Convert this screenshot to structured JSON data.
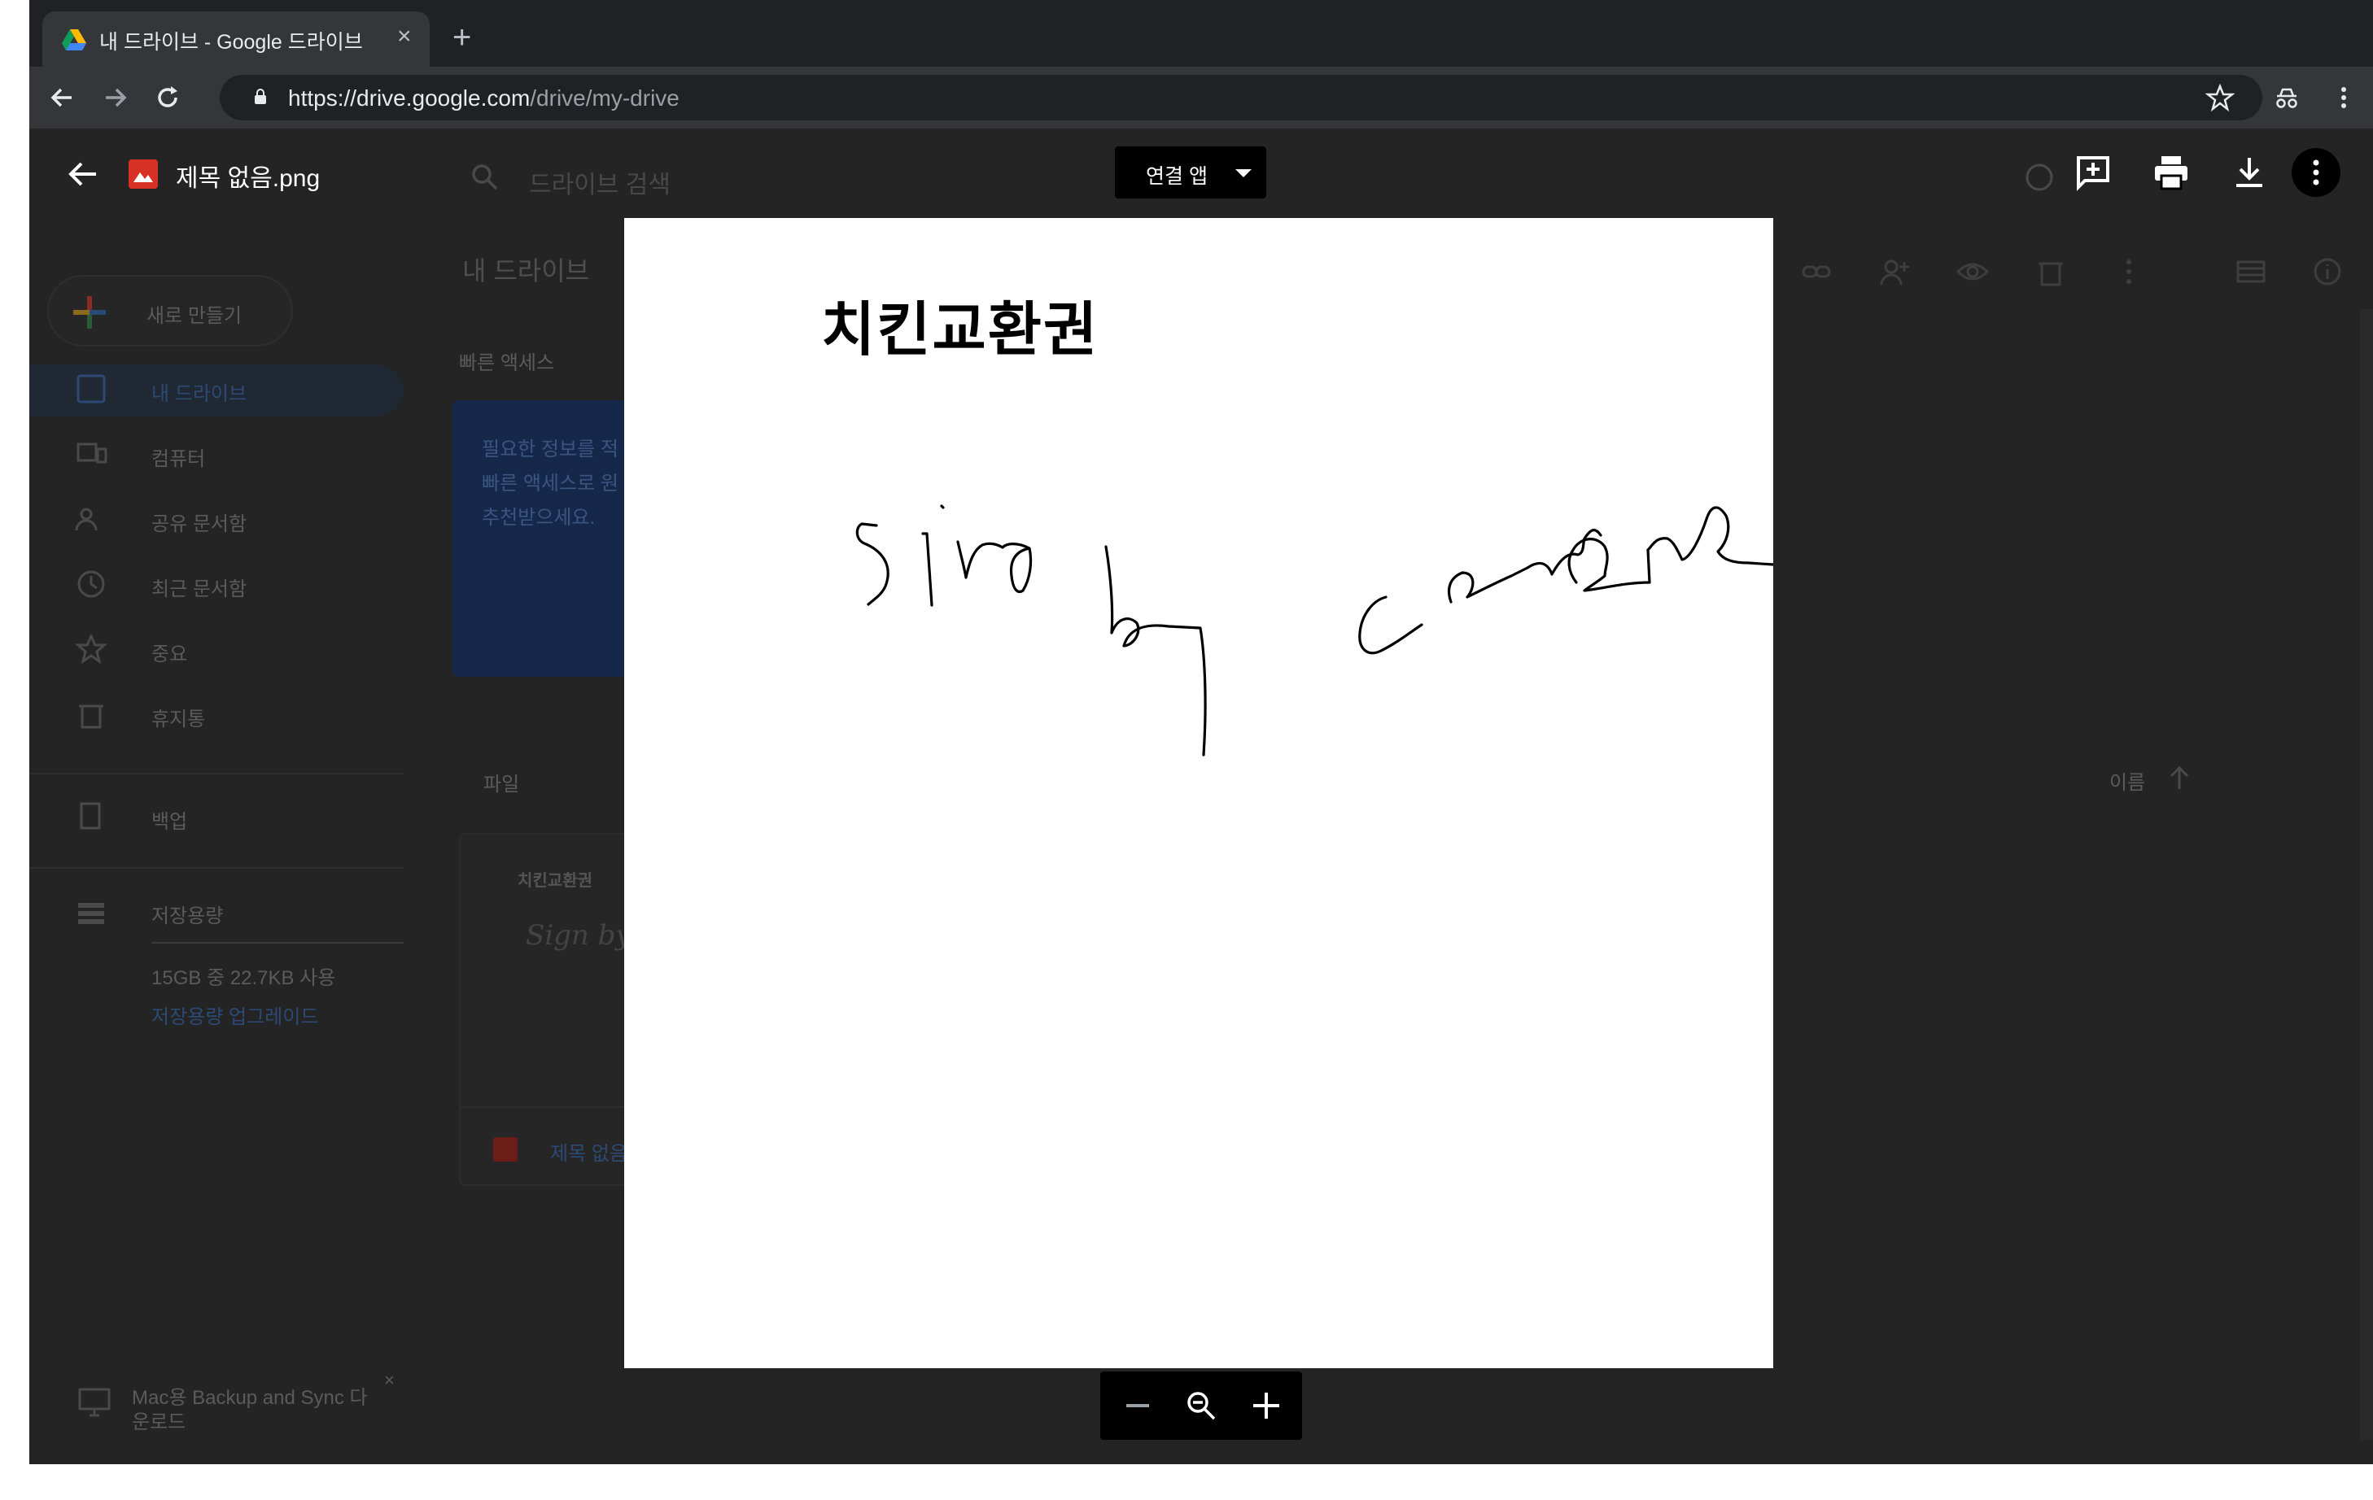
{
  "browser": {
    "tab_title": "내 드라이브 - Google 드라이브",
    "url_host": "https://drive.google.com",
    "url_path": "/drive/my-drive"
  },
  "drive_background": {
    "search_placeholder": "드라이브 검색",
    "new_button": "새로 만들기",
    "breadcrumb": "내 드라이브",
    "quick_access": "빠른 액세스",
    "nav": [
      "내 드라이브",
      "컴퓨터",
      "공유 문서함",
      "최근 문서함",
      "중요",
      "휴지통"
    ],
    "backup": "백업",
    "storage": "저장용량",
    "storage_usage": "15GB 중 22.7KB 사용",
    "storage_upgrade": "저장용량 업그레이드",
    "qa_card_lines": [
      "필요한 정보를 적",
      "빠른 액세스로 원",
      "추천받으세요."
    ],
    "files_heading": "파일",
    "sort_label": "이름",
    "file_card_title": "치킨교환권",
    "file_card_preview": "Sign by",
    "file_card_name": "제목 없음",
    "promo": [
      "Mac용 Backup and Sync 다",
      "운로드"
    ]
  },
  "viewer": {
    "file_name": "제목 없음.png",
    "open_with": "연결 앱",
    "image_title": "치킨교환권",
    "actions": [
      "add-comment-icon",
      "print-icon",
      "download-icon",
      "more-vert-icon"
    ],
    "zoom": [
      "zoom-out-icon",
      "zoom-reset-icon",
      "zoom-in-icon"
    ]
  }
}
